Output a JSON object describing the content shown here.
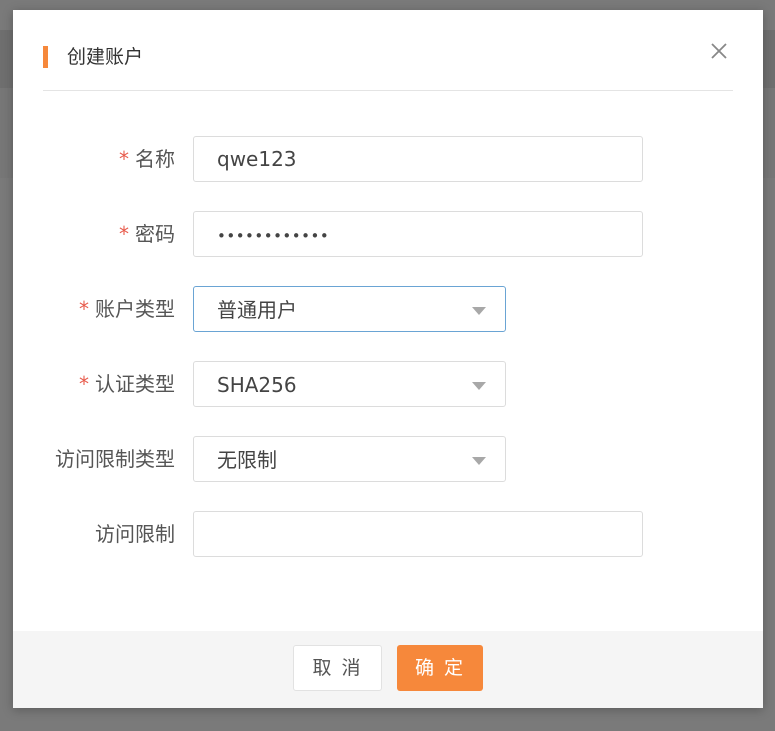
{
  "dialog": {
    "title": "创建账户",
    "close_icon": "close-icon",
    "accent_color": "#f6883b"
  },
  "form": {
    "name": {
      "label": "名称",
      "required": "*",
      "value": "qwe123"
    },
    "password": {
      "label": "密码",
      "required": "*",
      "value": "••••••••••••"
    },
    "account_type": {
      "label": "账户类型",
      "required": "*",
      "value": "普通用户"
    },
    "auth_type": {
      "label": "认证类型",
      "required": "*",
      "value": "SHA256"
    },
    "access_limit_type": {
      "label": "访问限制类型",
      "value": "无限制"
    },
    "access_limit": {
      "label": "访问限制",
      "value": ""
    }
  },
  "footer": {
    "cancel_label": "取 消",
    "confirm_label": "确 定"
  }
}
